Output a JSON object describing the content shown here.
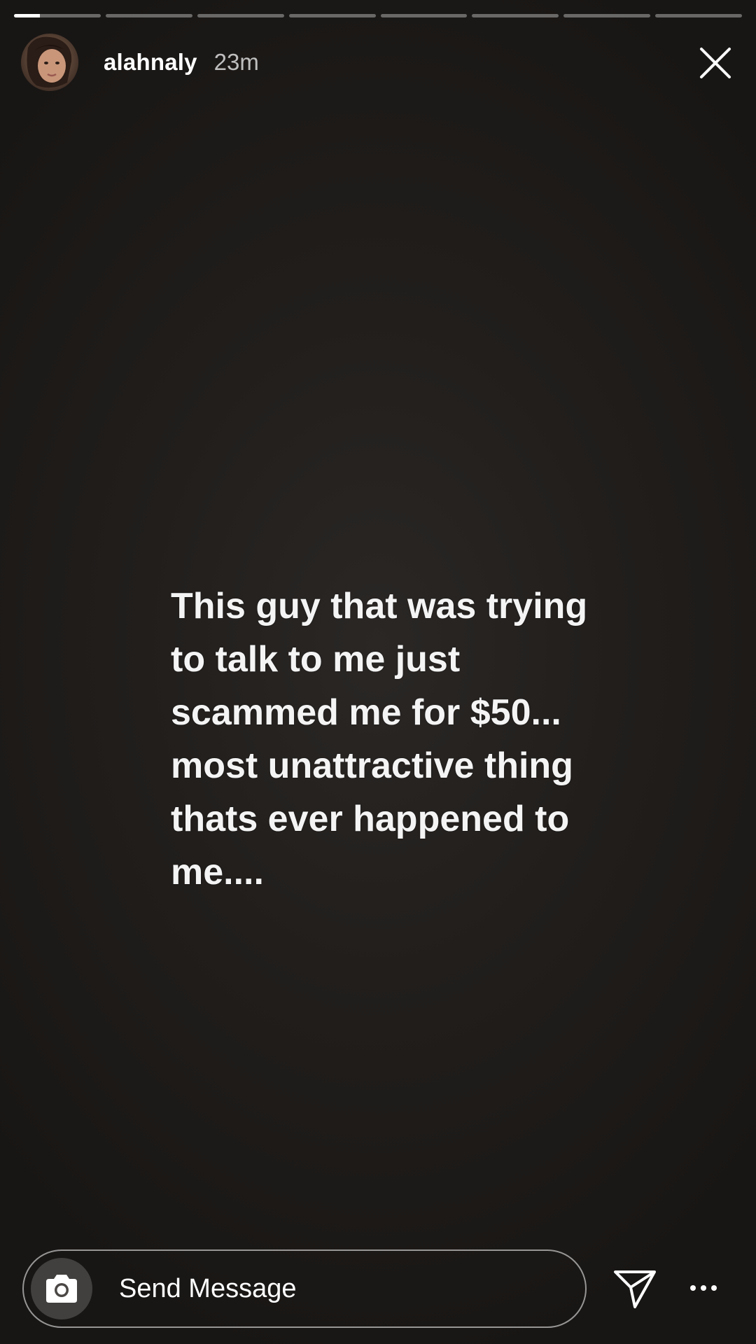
{
  "progress": {
    "segment_count": 8,
    "active_index": 0,
    "active_fill": 0.3
  },
  "header": {
    "username": "alahnaly",
    "timestamp": "23m",
    "avatar_icon": "profile-photo",
    "close_icon": "close-icon"
  },
  "story": {
    "text": "This guy that was trying\nto talk to me just\nscammed me for $50...\nmost unattractive thing\nthats ever happened to\nme...."
  },
  "reply": {
    "placeholder": "Send Message",
    "camera_icon": "camera-icon",
    "send_icon": "paper-plane-icon",
    "more_icon": "more-icon"
  },
  "colors": {
    "background": "#211e1c",
    "text": "#ffffff"
  }
}
